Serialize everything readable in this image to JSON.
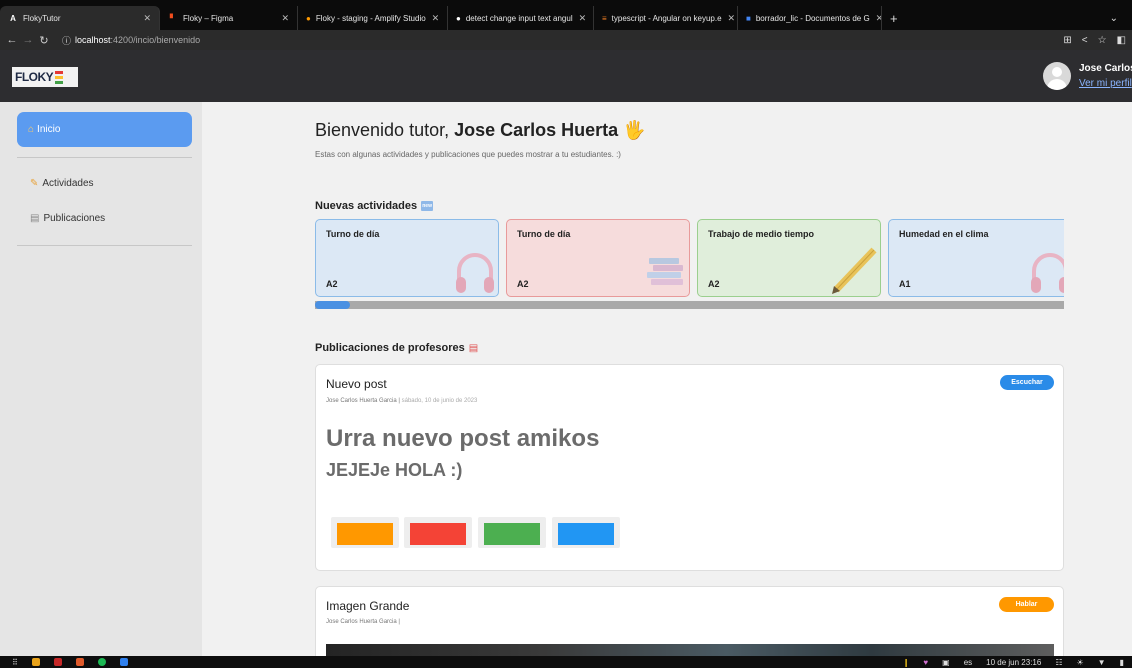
{
  "browser": {
    "tabs": [
      {
        "icon": "amplify-icon",
        "label": "FlokyTutor",
        "active": true
      },
      {
        "icon": "figma-icon",
        "label": "Floky – Figma",
        "active": false
      },
      {
        "icon": "amplify-orange-icon",
        "label": "Floky - staging - Amplify Studio",
        "active": false
      },
      {
        "icon": "github-icon",
        "label": "detect change input text angul",
        "active": false
      },
      {
        "icon": "stackoverflow-icon",
        "label": "typescript - Angular on keyup.e",
        "active": false
      },
      {
        "icon": "docs-icon",
        "label": "borrador_lic - Documentos de G",
        "active": false
      }
    ],
    "new_tab": "+",
    "url_host": "localhost",
    "url_path": ":4200/incio/bienvenido"
  },
  "header": {
    "logo": "FLOKY",
    "user_name": "Jose Carlos",
    "profile_link": "Ver mi perfil"
  },
  "sidebar": {
    "active_item": {
      "icon": "home-icon",
      "label": "Inicio"
    },
    "items": [
      {
        "icon": "pencil-icon",
        "label": "Actividades"
      },
      {
        "icon": "newspaper-icon",
        "label": "Publicaciones"
      }
    ]
  },
  "main": {
    "welcome_prefix": "Bienvenido tutor, ",
    "welcome_name": "Jose Carlos Huerta",
    "welcome_emoji": "🖐",
    "subtitle": "Estas con algunas actividades y publicaciones que puedes mostrar a tu estudiantes. :)",
    "activities_title": "Nuevas actividades",
    "activities_badge": "new",
    "activities": [
      {
        "title": "Turno de día",
        "level": "A2",
        "art": "headphones"
      },
      {
        "title": "Turno de día",
        "level": "A2",
        "art": "books"
      },
      {
        "title": "Trabajo de medio tiempo",
        "level": "A2",
        "art": "pencil"
      },
      {
        "title": "Humedad en el clima",
        "level": "A1",
        "art": "headphones"
      }
    ],
    "carousel_scroll_fraction": 0.05,
    "posts_title": "Publicaciones de profesores",
    "posts": [
      {
        "title": "Nuevo post",
        "author": "Jose Carlos Huerta Garcia",
        "date": "sábado, 10 de junio de 2023",
        "button": "Escuchar",
        "button_color": "#2a8be8",
        "heading": "Urra nuevo post amikos",
        "subheading": "JEJEJe HOLA :)",
        "swatches": [
          "#ff9800",
          "#f44336",
          "#4caf50",
          "#2196f3"
        ]
      },
      {
        "title": "Imagen Grande",
        "author": "Jose Carlos Huerta Garcia",
        "date": "",
        "button": "Hablar",
        "button_color": "#ff9800"
      }
    ]
  },
  "taskbar": {
    "lang": "es",
    "datetime": "10 de jun  23:16"
  },
  "colors": {
    "accent_blue": "#5b9bf0",
    "card_blue_bg": "#dce8f5",
    "card_red_bg": "#f6dcdc",
    "card_green_bg": "#e0eedb"
  }
}
